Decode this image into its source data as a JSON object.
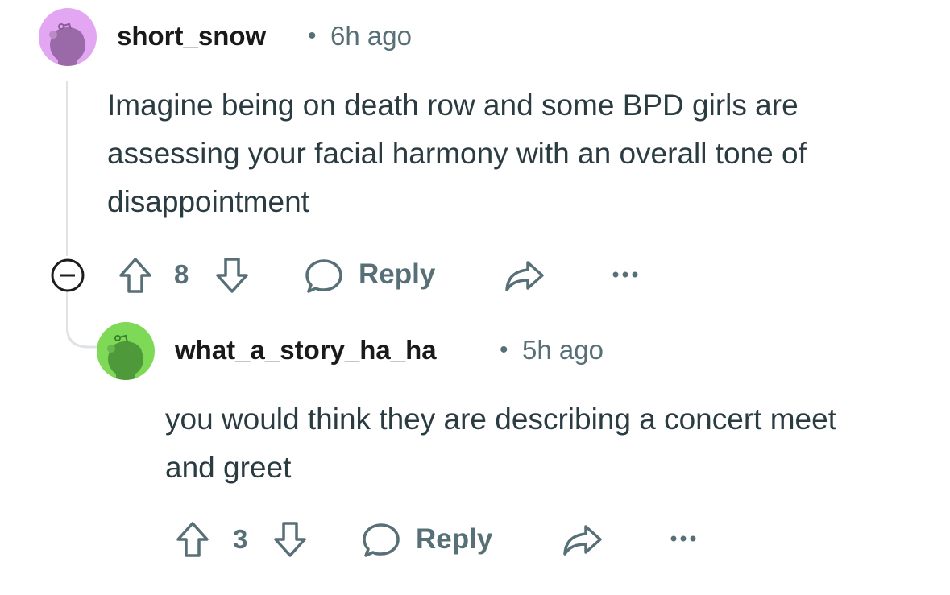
{
  "comments": [
    {
      "username": "short_snow",
      "separator": "•",
      "time": "6h ago",
      "body": "Imagine being on death row and some BPD girls are assessing your facial harmony with an overall tone of disappointment",
      "score": "8",
      "reply_label": "Reply",
      "avatar_color": "#e3a6f2"
    },
    {
      "username": "what_a_story_ha_ha",
      "separator": "•",
      "time": "5h ago",
      "body": "you would think they are describing a concert meet and greet",
      "score": "3",
      "reply_label": "Reply",
      "avatar_color": "#7ed957"
    }
  ]
}
